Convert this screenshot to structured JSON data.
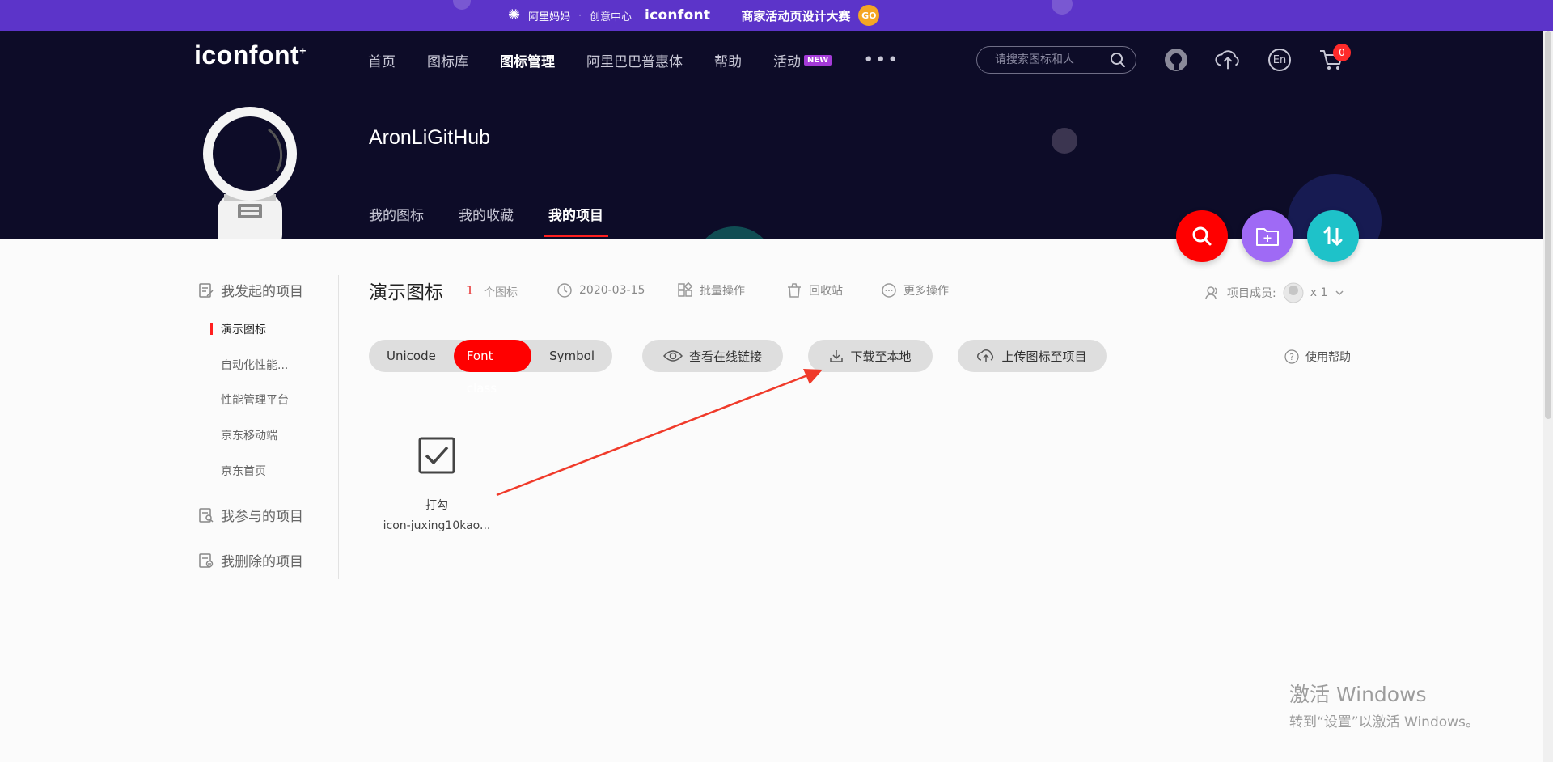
{
  "promo": {
    "alibaba": "阿里妈妈",
    "separator": "·",
    "creative": "创意中心",
    "brand": "iconfont",
    "contest": "商家活动页设计大赛",
    "go": "GO"
  },
  "header": {
    "logo": "iconfont",
    "logo_plus": "+",
    "nav": [
      {
        "label": "首页"
      },
      {
        "label": "图标库"
      },
      {
        "label": "图标管理"
      },
      {
        "label": "阿里巴巴普惠体"
      },
      {
        "label": "帮助"
      },
      {
        "label": "活动"
      }
    ],
    "new_badge": "NEW",
    "more": "•••",
    "search_placeholder": "请搜索图标和人",
    "lang": "En",
    "cart_count": "0"
  },
  "profile": {
    "username": "AronLiGitHub",
    "tabs": [
      {
        "label": "我的图标"
      },
      {
        "label": "我的收藏"
      },
      {
        "label": "我的项目"
      }
    ]
  },
  "sidebar": {
    "my_projects": "我发起的项目",
    "projects": [
      {
        "label": "演示图标"
      },
      {
        "label": "自动化性能..."
      },
      {
        "label": "性能管理平台"
      },
      {
        "label": "京东移动端"
      },
      {
        "label": "京东首页"
      }
    ],
    "joined_projects": "我参与的项目",
    "deleted_projects": "我删除的项目"
  },
  "project": {
    "title": "演示图标",
    "icon_count": "1",
    "icon_count_label": "个图标",
    "date": "2020-03-15",
    "batch": "批量操作",
    "recycle": "回收站",
    "more_ops": "更多操作",
    "members_label": "项目成员:",
    "members_count": "x 1"
  },
  "toolbar": {
    "segments": [
      {
        "label": "Unicode"
      },
      {
        "label": "Font class"
      },
      {
        "label": "Symbol"
      }
    ],
    "view_online": "查看在线链接",
    "download": "下载至本地",
    "upload": "上传图标至项目",
    "help": "使用帮助"
  },
  "icons": [
    {
      "name": "打勾",
      "code": "icon-juxing10kao..."
    }
  ],
  "watermark": {
    "line1": "激活 Windows",
    "line2": "转到“设置”以激活 Windows。"
  },
  "colors": {
    "accent_red": "#ff0000",
    "header_bg": "#0d0c28",
    "promo_bg": "#5c34c9",
    "purple_btn": "#9f6af5",
    "teal_btn": "#1ec2c9"
  }
}
